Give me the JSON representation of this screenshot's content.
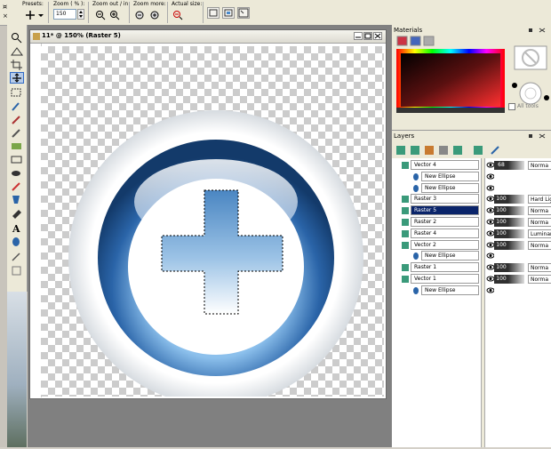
{
  "toolbar": {
    "presets_label": "Presets:",
    "zoom_pct_label": "Zoom ( % ):",
    "zoom_value": "150",
    "zoom_outin_label": "Zoom out / in:",
    "zoom_more_label": "Zoom more:",
    "actual_size_label": "Actual size:"
  },
  "document": {
    "title": "11* @ 150% (Raster 5)"
  },
  "materials": {
    "title": "Materials",
    "all_tools_label": "All tools"
  },
  "layers": {
    "title": "Layers",
    "rows": [
      {
        "name": "Vector 4",
        "opacity": "68",
        "blend": "Norma",
        "indent": 0,
        "selected": false
      },
      {
        "name": "New Ellipse",
        "opacity": "",
        "blend": "",
        "indent": 1,
        "selected": false
      },
      {
        "name": "New Ellipse",
        "opacity": "",
        "blend": "",
        "indent": 1,
        "selected": false
      },
      {
        "name": "Raster 3",
        "opacity": "100",
        "blend": "Hard Lig",
        "indent": 0,
        "selected": false
      },
      {
        "name": "Raster 5",
        "opacity": "100",
        "blend": "Norma",
        "indent": 0,
        "selected": true
      },
      {
        "name": "Raster 2",
        "opacity": "100",
        "blend": "Norma",
        "indent": 0,
        "selected": false
      },
      {
        "name": "Raster 4",
        "opacity": "100",
        "blend": "Luminanc",
        "indent": 0,
        "selected": false
      },
      {
        "name": "Vector 2",
        "opacity": "100",
        "blend": "Norma",
        "indent": 0,
        "selected": false
      },
      {
        "name": "New Ellipse",
        "opacity": "",
        "blend": "",
        "indent": 1,
        "selected": false
      },
      {
        "name": "Raster 1",
        "opacity": "100",
        "blend": "Norma",
        "indent": 0,
        "selected": false
      },
      {
        "name": "Vector 1",
        "opacity": "100",
        "blend": "Norma",
        "indent": 0,
        "selected": false
      },
      {
        "name": "New Ellipse",
        "opacity": "",
        "blend": "",
        "indent": 1,
        "selected": false
      }
    ]
  },
  "colors": {
    "selection": "#0a246a",
    "ring_blue": "#2a64a8",
    "accent": "#4a8acb"
  }
}
